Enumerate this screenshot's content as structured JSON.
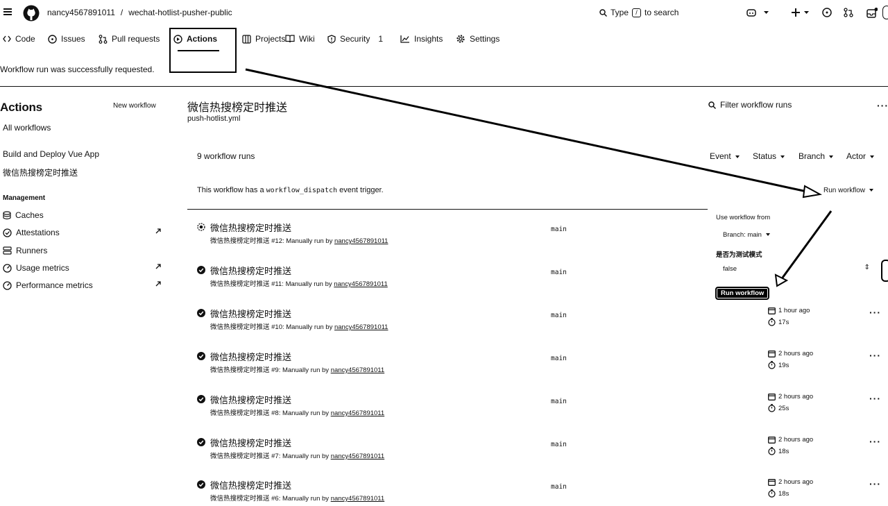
{
  "header": {
    "owner": "nancy4567891011",
    "separator": "/",
    "repo": "wechat-hotlist-pusher-public",
    "search_prefix": "Type",
    "search_key": "/",
    "search_suffix": "to search"
  },
  "repo_nav": {
    "tabs": [
      {
        "label": "Code"
      },
      {
        "label": "Issues"
      },
      {
        "label": "Pull requests"
      },
      {
        "label": "Actions"
      },
      {
        "label": "Projects"
      },
      {
        "label": "Wiki"
      },
      {
        "label": "Security",
        "count": "1"
      },
      {
        "label": "Insights"
      },
      {
        "label": "Settings"
      }
    ],
    "active": "Actions"
  },
  "flash": "Workflow run was successfully requested.",
  "sidebar": {
    "title": "Actions",
    "new_workflow": "New workflow",
    "all_workflows": "All workflows",
    "workflows": [
      "Build and Deploy Vue App",
      "微信热搜榜定时推送"
    ],
    "management_heading": "Management",
    "management": [
      {
        "label": "Caches",
        "icon": "database-icon",
        "external": false
      },
      {
        "label": "Attestations",
        "icon": "verified-icon",
        "external": true
      },
      {
        "label": "Runners",
        "icon": "server-icon",
        "external": false
      },
      {
        "label": "Usage metrics",
        "icon": "metrics-icon",
        "external": true
      },
      {
        "label": "Performance metrics",
        "icon": "metrics-icon",
        "external": true
      }
    ]
  },
  "main": {
    "workflow_title": "微信热搜榜定时推送",
    "workflow_file": "push-hotlist.yml",
    "filter_placeholder": "Filter workflow runs",
    "runs_count": "9 workflow runs",
    "filters": [
      "Event",
      "Status",
      "Branch",
      "Actor"
    ],
    "dispatch_prefix": "This workflow has a",
    "dispatch_code": "workflow_dispatch",
    "dispatch_suffix": "event trigger.",
    "run_workflow_label": "Run workflow"
  },
  "runs": [
    {
      "title": "微信热搜榜定时推送",
      "meta": "微信热搜榜定时推送 #12: Manually run by",
      "actor": "nancy4567891011",
      "branch": "main",
      "time": "",
      "duration": "",
      "status": "in-progress"
    },
    {
      "title": "微信热搜榜定时推送",
      "meta": "微信热搜榜定时推送 #11: Manually run by",
      "actor": "nancy4567891011",
      "branch": "main",
      "time": "",
      "duration": "",
      "status": "success"
    },
    {
      "title": "微信热搜榜定时推送",
      "meta": "微信热搜榜定时推送 #10: Manually run by",
      "actor": "nancy4567891011",
      "branch": "main",
      "time": "1 hour ago",
      "duration": "17s",
      "status": "success"
    },
    {
      "title": "微信热搜榜定时推送",
      "meta": "微信热搜榜定时推送 #9: Manually run by",
      "actor": "nancy4567891011",
      "branch": "main",
      "time": "2 hours ago",
      "duration": "19s",
      "status": "success"
    },
    {
      "title": "微信热搜榜定时推送",
      "meta": "微信热搜榜定时推送 #8: Manually run by",
      "actor": "nancy4567891011",
      "branch": "main",
      "time": "2 hours ago",
      "duration": "25s",
      "status": "success"
    },
    {
      "title": "微信热搜榜定时推送",
      "meta": "微信热搜榜定时推送 #7: Manually run by",
      "actor": "nancy4567891011",
      "branch": "main",
      "time": "2 hours ago",
      "duration": "18s",
      "status": "success"
    },
    {
      "title": "微信热搜榜定时推送",
      "meta": "微信热搜榜定时推送 #6: Manually run by",
      "actor": "nancy4567891011",
      "branch": "main",
      "time": "2 hours ago",
      "duration": "18s",
      "status": "success"
    }
  ],
  "popover": {
    "heading": "Use workflow from",
    "branch": "Branch: main",
    "input_label": "是否为测试模式",
    "input_value": "false",
    "submit": "Run workflow"
  },
  "colors": {
    "text": "#111111",
    "background": "#ffffff",
    "annotation": "#000000"
  }
}
